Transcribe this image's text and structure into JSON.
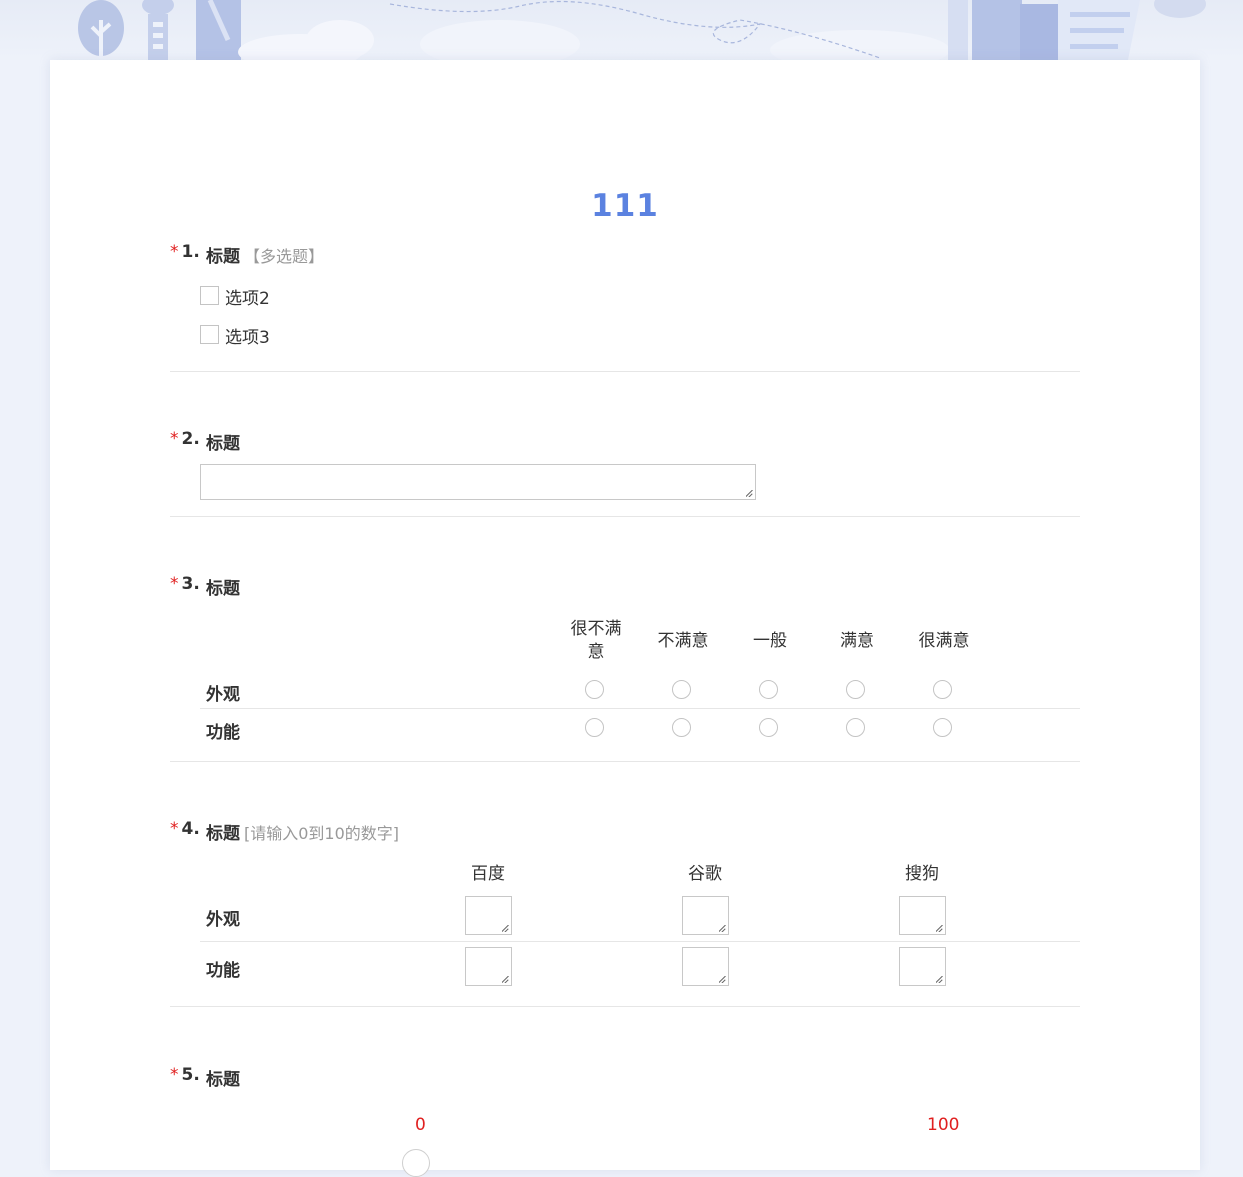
{
  "survey": {
    "title": "111"
  },
  "q1": {
    "number": "1.",
    "required_mark": "*",
    "title": "标题",
    "tag": "【多选题】",
    "options": [
      "选项2",
      "选项3"
    ]
  },
  "q2": {
    "number": "2.",
    "required_mark": "*",
    "title": "标题"
  },
  "q3": {
    "number": "3.",
    "required_mark": "*",
    "title": "标题",
    "columns": [
      "很不满\n意",
      "不满意",
      "一般",
      "满意",
      "很满意"
    ],
    "rows": [
      "外观",
      "功能"
    ]
  },
  "q4": {
    "number": "4.",
    "required_mark": "*",
    "title": "标题",
    "hint": "[请输入0到10的数字]",
    "columns": [
      "百度",
      "谷歌",
      "搜狗"
    ],
    "rows": [
      "外观",
      "功能"
    ]
  },
  "q5": {
    "number": "5.",
    "required_mark": "*",
    "title": "标题",
    "slider_min": "0",
    "slider_max": "100"
  }
}
